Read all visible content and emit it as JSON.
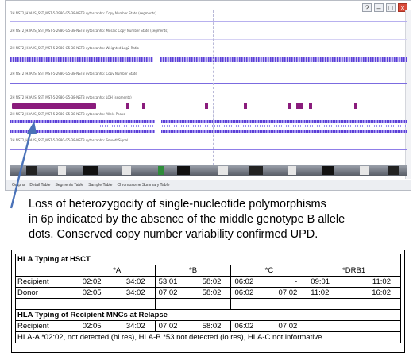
{
  "viewer": {
    "window_buttons": [
      "?",
      "–",
      "□",
      "×"
    ],
    "track_labels": [
      "2H NST2_H3A2S_SST_MST-5-2980-G5-38-NST3 cytoscanhp: Copy Number State (segments)",
      "2H NST2_H3A2S_SST_MST-5-2980-G5-38-NST3 cytoscanhp: Mosaic Copy Number State (segments)",
      "2H NST2_H3A2S_SST_MST-5-2980-G5-38-NST3 cytoscanhp: Weighted Log2 Ratio",
      "2H NST2_H3A2S_SST_MST-5-2980-G5-38-NST3 cytoscanhp: Copy Number State",
      "2H NST2_H3A2S_SST_MST-5-2980-G5-38-NST3 cytoscanhp: LOH (segments)",
      "2H NST2_H3A2S_SST_MST-5-2980-G5-38-NST3 cytoscanhp: Allele Peaks",
      "2H NST2_H3A2S_SST_MST-5-2980-G5-38-NST3 cytoscanhp: SmoothSignal"
    ],
    "footer_tabs": [
      "Graphs",
      "Detail Table",
      "Segments Table",
      "Sample Table",
      "Chromosome Summary Table"
    ],
    "colors": {
      "cnv_points": "#5b3fd6",
      "loh_segment": "#8a1c7c",
      "track_line": "#7b6be0"
    }
  },
  "caption": {
    "line1": "Loss of heterozygocity of single-nucleotide polymorphisms",
    "line2": "in 6p indicated by the absence of the middle genotype B allele",
    "line3": "dots. Conserved copy number variability confirmed UPD."
  },
  "hla": {
    "section1_title": "HLA Typing at HSCT",
    "columns": [
      "*A",
      "*B",
      "*C",
      "*DRB1"
    ],
    "recipient": {
      "label": "Recipient",
      "A": [
        "02:02",
        "34:02"
      ],
      "B": [
        "53:01",
        "58:02"
      ],
      "C": [
        "06:02",
        "-"
      ],
      "DRB1": [
        "09:01",
        "11:02"
      ]
    },
    "donor": {
      "label": "Donor",
      "A": [
        "02:05",
        "34:02"
      ],
      "B": [
        "07:02",
        "58:02"
      ],
      "C": [
        "06:02",
        "07:02"
      ],
      "DRB1": [
        "11:02",
        "16:02"
      ]
    },
    "section2_title": "HLA Typing of Recipient MNCs at Relapse",
    "relapse": {
      "label": "Recipient",
      "A": [
        "02:05",
        "34:02"
      ],
      "B": [
        "07:02",
        "58:02"
      ],
      "C": [
        "06:02",
        "07:02"
      ]
    },
    "footnote": "HLA-A *02:02, not detected (hi res), HLA-B *53 not detected (lo res), HLA-C not informative"
  }
}
